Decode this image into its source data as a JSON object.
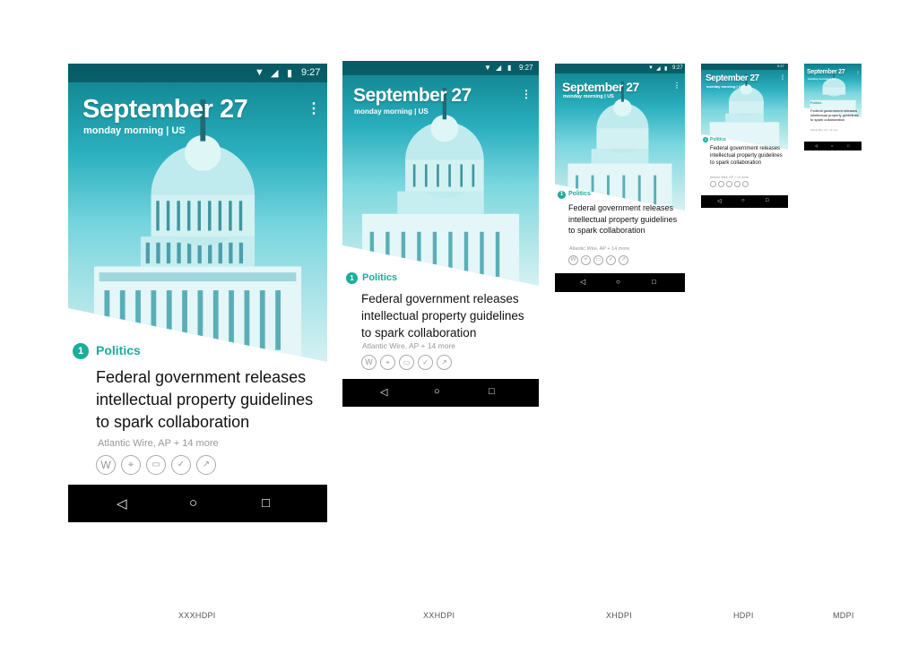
{
  "screen": {
    "status_time": "9:27",
    "date": "September 27",
    "subtitle": "monday morning | US",
    "menu_icon": "overflow-menu-icon",
    "story_number": "1",
    "category": "Politics",
    "headline": "Federal government releases intellectual property guidelines to spark collaboration",
    "source": "Atlantic Wire, AP + 14 more",
    "action_icons": [
      "wikipedia-icon",
      "map-pin-icon",
      "video-icon",
      "twitter-icon",
      "trending-icon"
    ],
    "nav_icons": [
      "back-icon",
      "home-icon",
      "recents-icon"
    ]
  },
  "densities": [
    "XXXHDPI",
    "XXHDPI",
    "XHDPI",
    "HDPI",
    "MDPI"
  ],
  "colors": {
    "accent": "#1aae9a",
    "hero_tint": "#2bb0bf",
    "navbar": "#000000"
  }
}
